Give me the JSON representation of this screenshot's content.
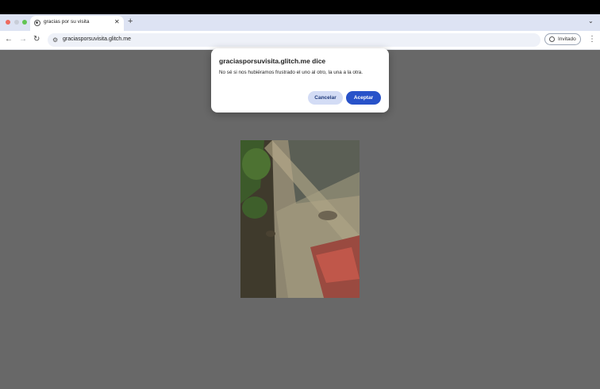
{
  "tab": {
    "title": "gracias por su visita",
    "close": "✕"
  },
  "new_tab": "+",
  "tab_search": "⌄",
  "nav": {
    "back": "←",
    "forward": "→",
    "reload": "↻"
  },
  "site_info_icon": "⚙",
  "address": {
    "url": "graciasporsuvisita.glitch.me"
  },
  "profile": {
    "label": "Invitado"
  },
  "menu": "⋮",
  "dialog": {
    "title": "graciasporsuvisita.glitch.me dice",
    "message": "No sé si nos hubiéramos frustrado el uno al otro, la una a la otra.",
    "cancel_label": "Cancelar",
    "accept_label": "Aceptar"
  },
  "colors": {
    "accent": "#2852c9",
    "tabstrip": "#dde3f3",
    "page_bg": "#686868"
  }
}
